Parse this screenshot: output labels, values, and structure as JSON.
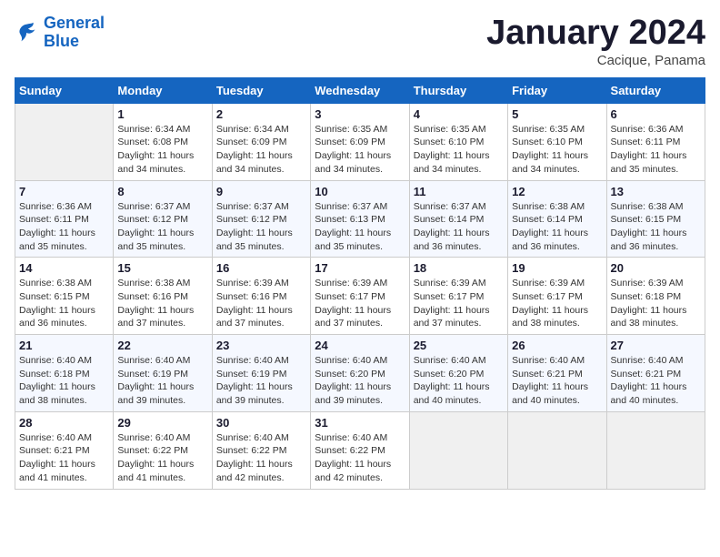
{
  "header": {
    "logo_line1": "General",
    "logo_line2": "Blue",
    "month": "January 2024",
    "location": "Cacique, Panama"
  },
  "weekdays": [
    "Sunday",
    "Monday",
    "Tuesday",
    "Wednesday",
    "Thursday",
    "Friday",
    "Saturday"
  ],
  "weeks": [
    [
      {
        "day": "",
        "empty": true
      },
      {
        "day": "1",
        "sunrise": "Sunrise: 6:34 AM",
        "sunset": "Sunset: 6:08 PM",
        "daylight": "Daylight: 11 hours and 34 minutes."
      },
      {
        "day": "2",
        "sunrise": "Sunrise: 6:34 AM",
        "sunset": "Sunset: 6:09 PM",
        "daylight": "Daylight: 11 hours and 34 minutes."
      },
      {
        "day": "3",
        "sunrise": "Sunrise: 6:35 AM",
        "sunset": "Sunset: 6:09 PM",
        "daylight": "Daylight: 11 hours and 34 minutes."
      },
      {
        "day": "4",
        "sunrise": "Sunrise: 6:35 AM",
        "sunset": "Sunset: 6:10 PM",
        "daylight": "Daylight: 11 hours and 34 minutes."
      },
      {
        "day": "5",
        "sunrise": "Sunrise: 6:35 AM",
        "sunset": "Sunset: 6:10 PM",
        "daylight": "Daylight: 11 hours and 34 minutes."
      },
      {
        "day": "6",
        "sunrise": "Sunrise: 6:36 AM",
        "sunset": "Sunset: 6:11 PM",
        "daylight": "Daylight: 11 hours and 35 minutes."
      }
    ],
    [
      {
        "day": "7",
        "sunrise": "Sunrise: 6:36 AM",
        "sunset": "Sunset: 6:11 PM",
        "daylight": "Daylight: 11 hours and 35 minutes."
      },
      {
        "day": "8",
        "sunrise": "Sunrise: 6:37 AM",
        "sunset": "Sunset: 6:12 PM",
        "daylight": "Daylight: 11 hours and 35 minutes."
      },
      {
        "day": "9",
        "sunrise": "Sunrise: 6:37 AM",
        "sunset": "Sunset: 6:12 PM",
        "daylight": "Daylight: 11 hours and 35 minutes."
      },
      {
        "day": "10",
        "sunrise": "Sunrise: 6:37 AM",
        "sunset": "Sunset: 6:13 PM",
        "daylight": "Daylight: 11 hours and 35 minutes."
      },
      {
        "day": "11",
        "sunrise": "Sunrise: 6:37 AM",
        "sunset": "Sunset: 6:14 PM",
        "daylight": "Daylight: 11 hours and 36 minutes."
      },
      {
        "day": "12",
        "sunrise": "Sunrise: 6:38 AM",
        "sunset": "Sunset: 6:14 PM",
        "daylight": "Daylight: 11 hours and 36 minutes."
      },
      {
        "day": "13",
        "sunrise": "Sunrise: 6:38 AM",
        "sunset": "Sunset: 6:15 PM",
        "daylight": "Daylight: 11 hours and 36 minutes."
      }
    ],
    [
      {
        "day": "14",
        "sunrise": "Sunrise: 6:38 AM",
        "sunset": "Sunset: 6:15 PM",
        "daylight": "Daylight: 11 hours and 36 minutes."
      },
      {
        "day": "15",
        "sunrise": "Sunrise: 6:38 AM",
        "sunset": "Sunset: 6:16 PM",
        "daylight": "Daylight: 11 hours and 37 minutes."
      },
      {
        "day": "16",
        "sunrise": "Sunrise: 6:39 AM",
        "sunset": "Sunset: 6:16 PM",
        "daylight": "Daylight: 11 hours and 37 minutes."
      },
      {
        "day": "17",
        "sunrise": "Sunrise: 6:39 AM",
        "sunset": "Sunset: 6:17 PM",
        "daylight": "Daylight: 11 hours and 37 minutes."
      },
      {
        "day": "18",
        "sunrise": "Sunrise: 6:39 AM",
        "sunset": "Sunset: 6:17 PM",
        "daylight": "Daylight: 11 hours and 37 minutes."
      },
      {
        "day": "19",
        "sunrise": "Sunrise: 6:39 AM",
        "sunset": "Sunset: 6:17 PM",
        "daylight": "Daylight: 11 hours and 38 minutes."
      },
      {
        "day": "20",
        "sunrise": "Sunrise: 6:39 AM",
        "sunset": "Sunset: 6:18 PM",
        "daylight": "Daylight: 11 hours and 38 minutes."
      }
    ],
    [
      {
        "day": "21",
        "sunrise": "Sunrise: 6:40 AM",
        "sunset": "Sunset: 6:18 PM",
        "daylight": "Daylight: 11 hours and 38 minutes."
      },
      {
        "day": "22",
        "sunrise": "Sunrise: 6:40 AM",
        "sunset": "Sunset: 6:19 PM",
        "daylight": "Daylight: 11 hours and 39 minutes."
      },
      {
        "day": "23",
        "sunrise": "Sunrise: 6:40 AM",
        "sunset": "Sunset: 6:19 PM",
        "daylight": "Daylight: 11 hours and 39 minutes."
      },
      {
        "day": "24",
        "sunrise": "Sunrise: 6:40 AM",
        "sunset": "Sunset: 6:20 PM",
        "daylight": "Daylight: 11 hours and 39 minutes."
      },
      {
        "day": "25",
        "sunrise": "Sunrise: 6:40 AM",
        "sunset": "Sunset: 6:20 PM",
        "daylight": "Daylight: 11 hours and 40 minutes."
      },
      {
        "day": "26",
        "sunrise": "Sunrise: 6:40 AM",
        "sunset": "Sunset: 6:21 PM",
        "daylight": "Daylight: 11 hours and 40 minutes."
      },
      {
        "day": "27",
        "sunrise": "Sunrise: 6:40 AM",
        "sunset": "Sunset: 6:21 PM",
        "daylight": "Daylight: 11 hours and 40 minutes."
      }
    ],
    [
      {
        "day": "28",
        "sunrise": "Sunrise: 6:40 AM",
        "sunset": "Sunset: 6:21 PM",
        "daylight": "Daylight: 11 hours and 41 minutes."
      },
      {
        "day": "29",
        "sunrise": "Sunrise: 6:40 AM",
        "sunset": "Sunset: 6:22 PM",
        "daylight": "Daylight: 11 hours and 41 minutes."
      },
      {
        "day": "30",
        "sunrise": "Sunrise: 6:40 AM",
        "sunset": "Sunset: 6:22 PM",
        "daylight": "Daylight: 11 hours and 42 minutes."
      },
      {
        "day": "31",
        "sunrise": "Sunrise: 6:40 AM",
        "sunset": "Sunset: 6:22 PM",
        "daylight": "Daylight: 11 hours and 42 minutes."
      },
      {
        "day": "",
        "empty": true
      },
      {
        "day": "",
        "empty": true
      },
      {
        "day": "",
        "empty": true
      }
    ]
  ]
}
